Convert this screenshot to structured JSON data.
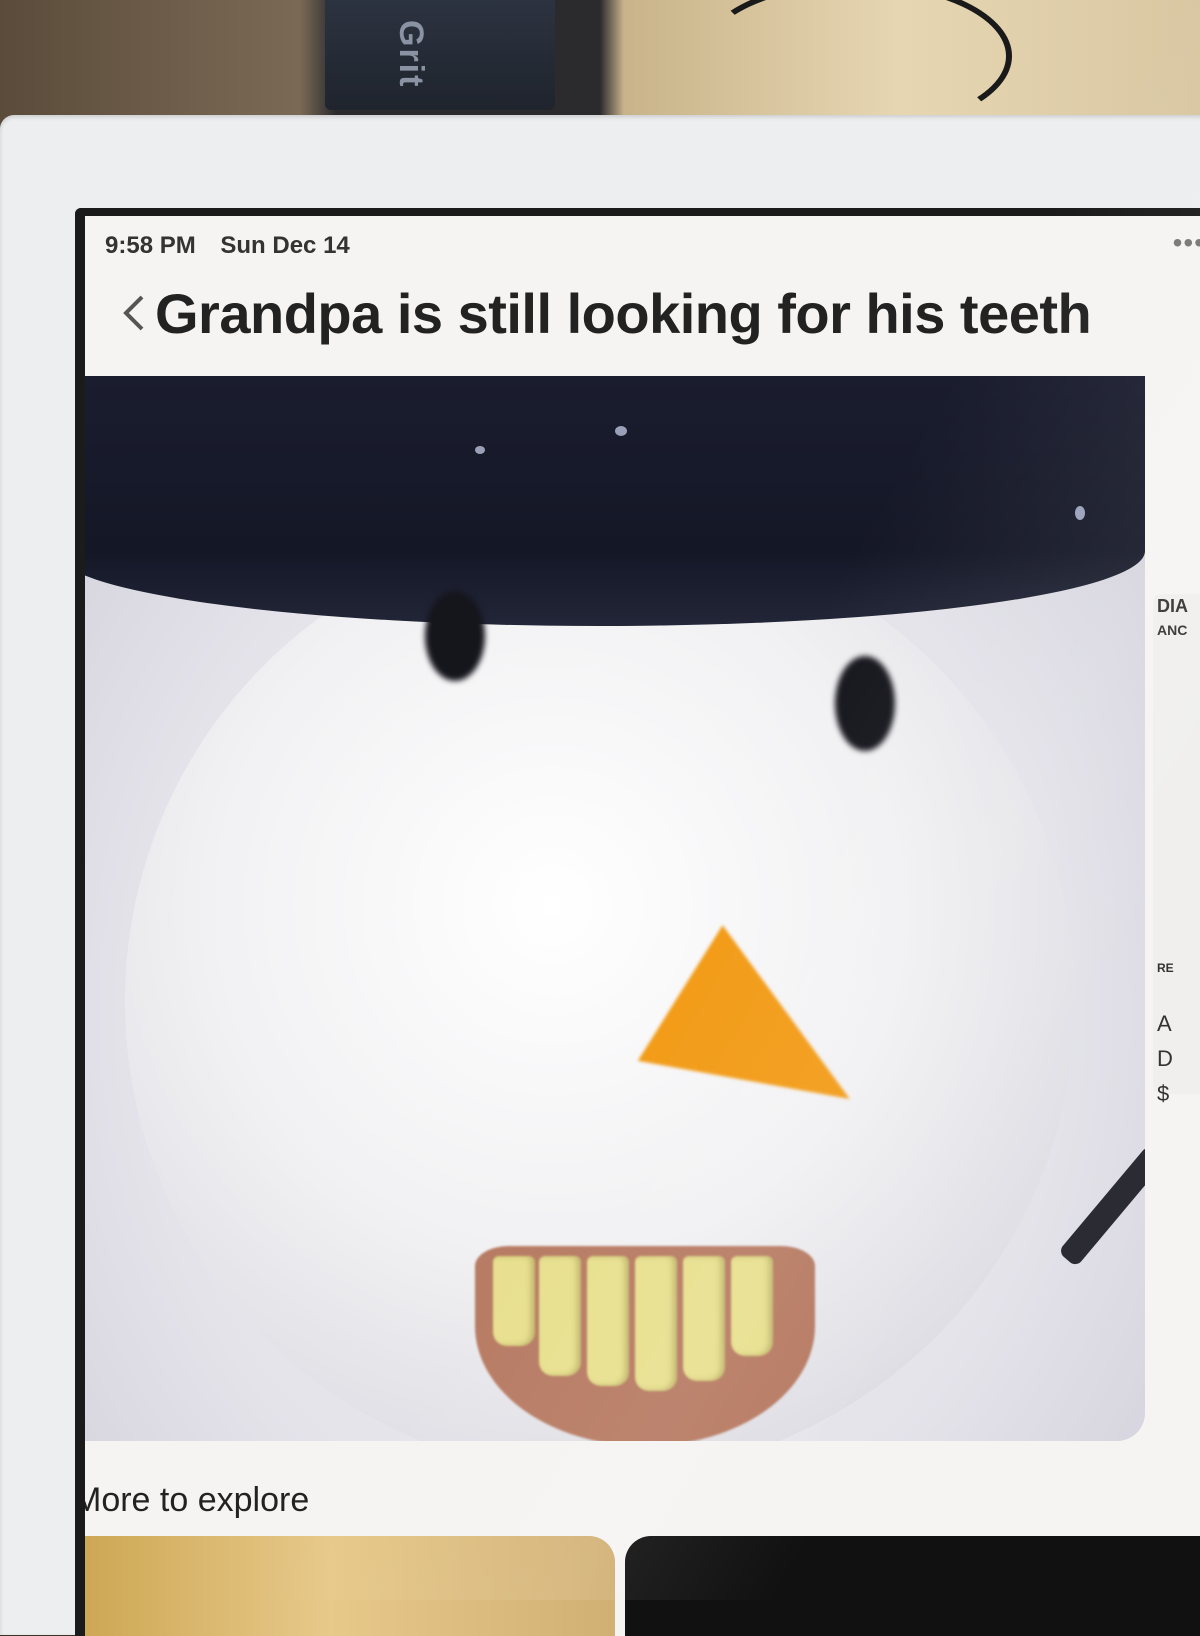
{
  "background": {
    "box_label": "Grit"
  },
  "status_bar": {
    "time": "9:58 PM",
    "date": "Sun Dec 14"
  },
  "pin": {
    "title": "Grandpa is still looking for his teeth",
    "more_icon": "ellipsis-icon",
    "back_icon": "chevron-left-icon",
    "lens_icon": "visual-search-icon"
  },
  "side_card": {
    "line1": "DIA",
    "line2": "ANC",
    "line3": "RE",
    "line4": "A",
    "line5": "D",
    "line6": "$"
  },
  "explore": {
    "heading": "More to explore"
  },
  "colors": {
    "accent_nose": "#f29a14",
    "hat": "#141726",
    "screen_bg": "#f5f4f2"
  }
}
